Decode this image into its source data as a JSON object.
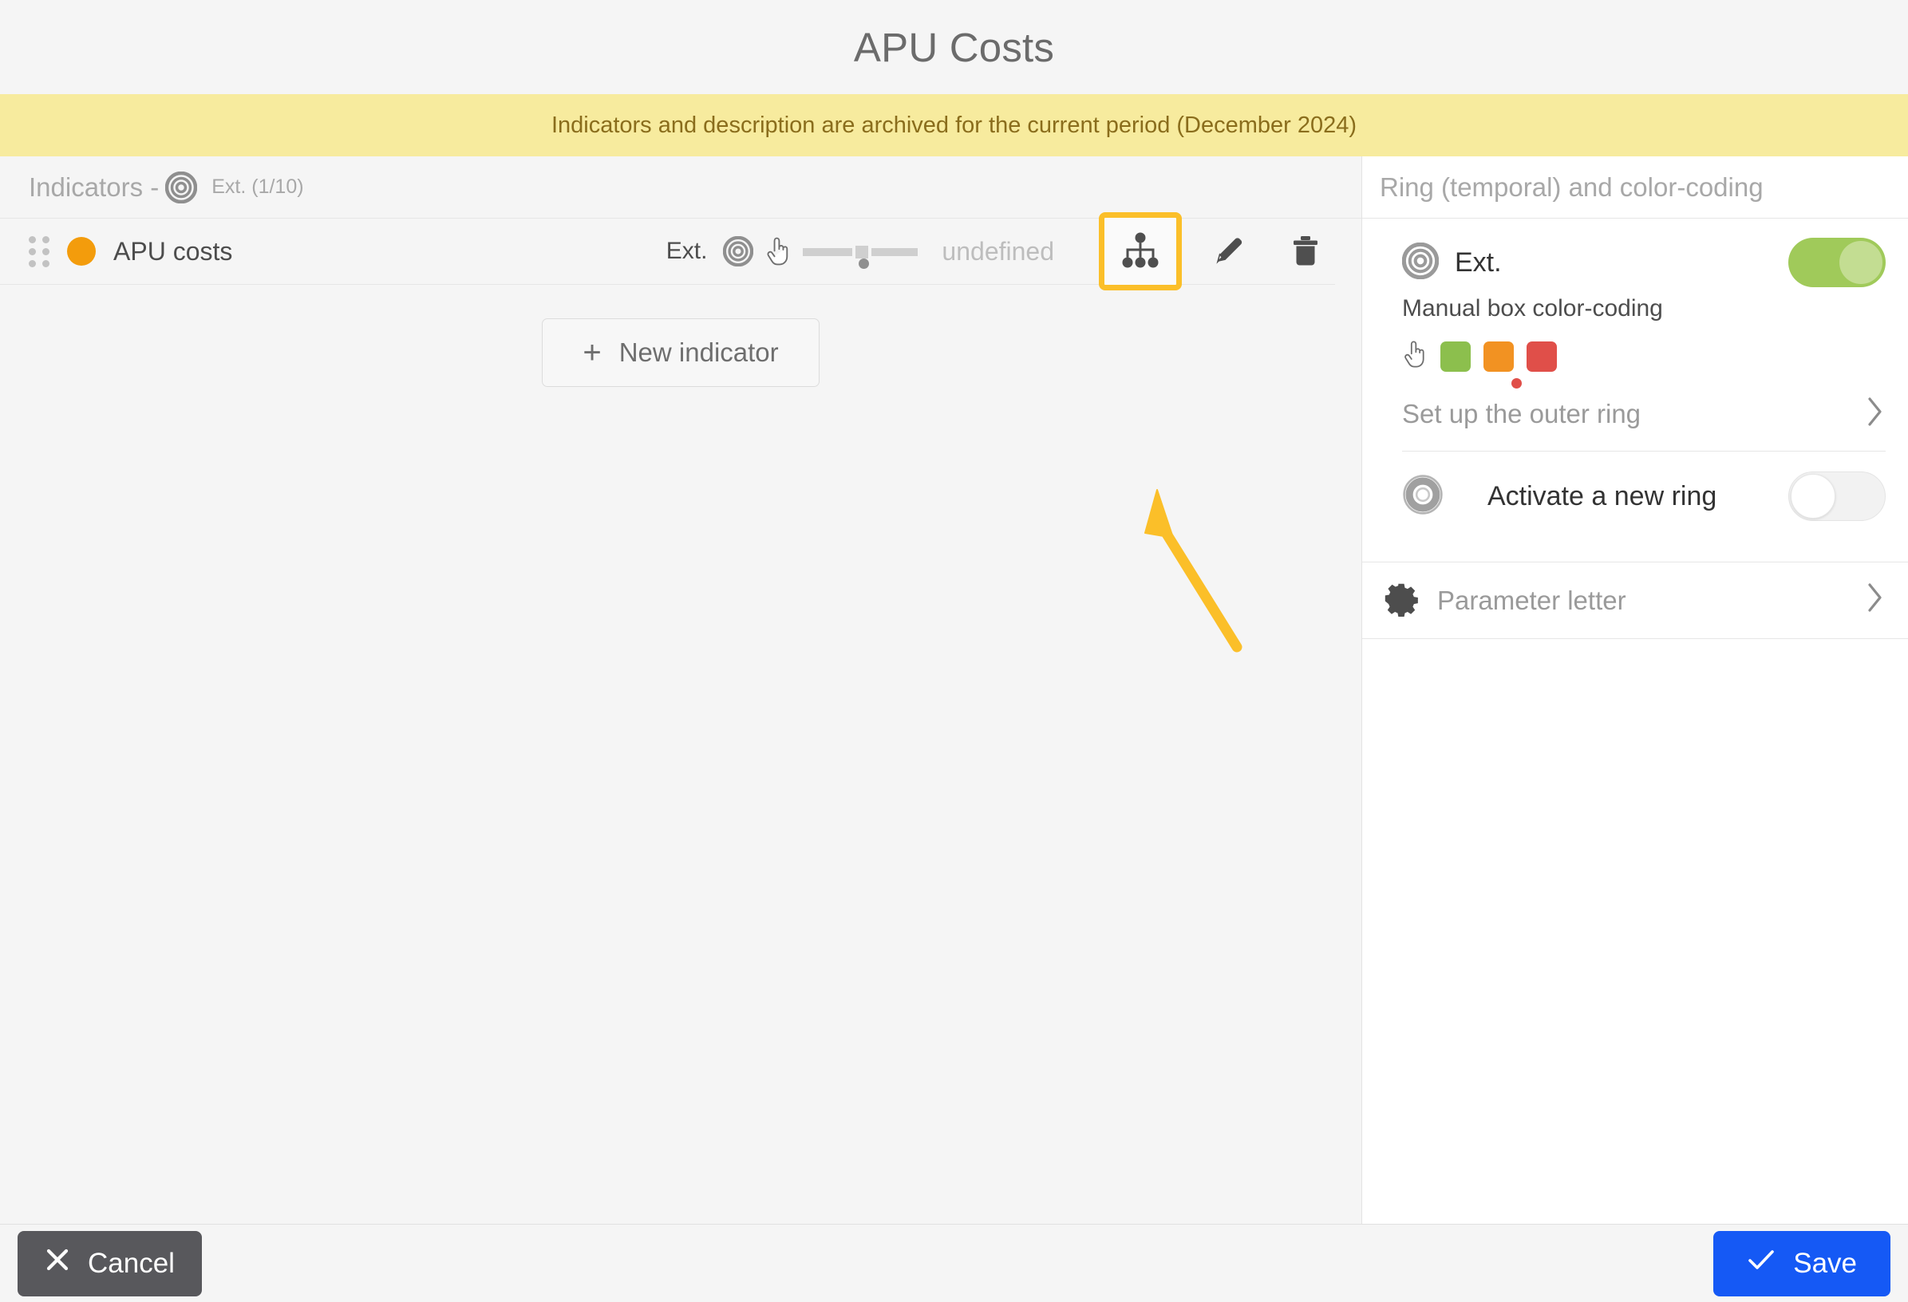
{
  "header": {
    "title": "APU Costs"
  },
  "banner": {
    "text": "Indicators and description are archived for the current period (December 2024)"
  },
  "indicators_panel": {
    "heading_label": "Indicators -",
    "heading_ring_icon": "target-ring-icon",
    "heading_sub": "Ext. (1/10)",
    "rows": [
      {
        "drag_handle_icon": "drag-handle-icon",
        "color": "#F39C0C",
        "name": "APU costs",
        "meta_ring_label": "Ext.",
        "meta_ring_icon": "target-ring-icon",
        "meta_hand_icon": "pointing-hand-icon",
        "meta_gauge_icon": "gauge-bar-icon",
        "meta_value": "undefined",
        "action_hierarchy_icon": "hierarchy-icon",
        "action_edit_icon": "pencil-icon",
        "action_delete_icon": "trash-icon"
      }
    ],
    "new_indicator": {
      "plus": "+",
      "label": "New indicator"
    }
  },
  "right_panel": {
    "title": "Ring (temporal) and color-coding",
    "ring_block": {
      "ring_icon": "target-ring-icon",
      "ring_label": "Ext.",
      "ring_toggle_state": "on",
      "manual_label": "Manual box color-coding",
      "hand_icon": "pointing-hand-icon",
      "swatches": [
        {
          "name": "green-swatch",
          "color": "#8CBF4D",
          "selected": false
        },
        {
          "name": "orange-swatch",
          "color": "#F29222",
          "selected": false
        },
        {
          "name": "red-swatch",
          "color": "#E04F49",
          "selected": true
        }
      ]
    },
    "outer_ring_link": {
      "label": "Set up the outer ring",
      "chevron_icon": "chevron-right-icon"
    },
    "activate_new_ring": {
      "ring_icon": "donut-ring-icon",
      "label": "Activate a new ring",
      "toggle_state": "off"
    },
    "parameter_letter": {
      "gear_icon": "gear-icon",
      "label": "Parameter letter",
      "chevron_icon": "chevron-right-icon"
    }
  },
  "footer": {
    "cancel": {
      "icon": "close-icon",
      "label": "Cancel"
    },
    "save": {
      "icon": "check-icon",
      "label": "Save"
    }
  },
  "annotation": {
    "arrow_icon": "arrow-pointer-annotation",
    "color": "#FBBF29"
  },
  "colors": {
    "page_bg": "#F5F5F5",
    "banner_bg": "#F7EB9E",
    "banner_text": "#8A6D1C",
    "accent_highlight": "#FBBF29",
    "save_blue": "#1559F5",
    "cancel_gray": "#58585C",
    "toggle_green": "#A0CA5A"
  }
}
